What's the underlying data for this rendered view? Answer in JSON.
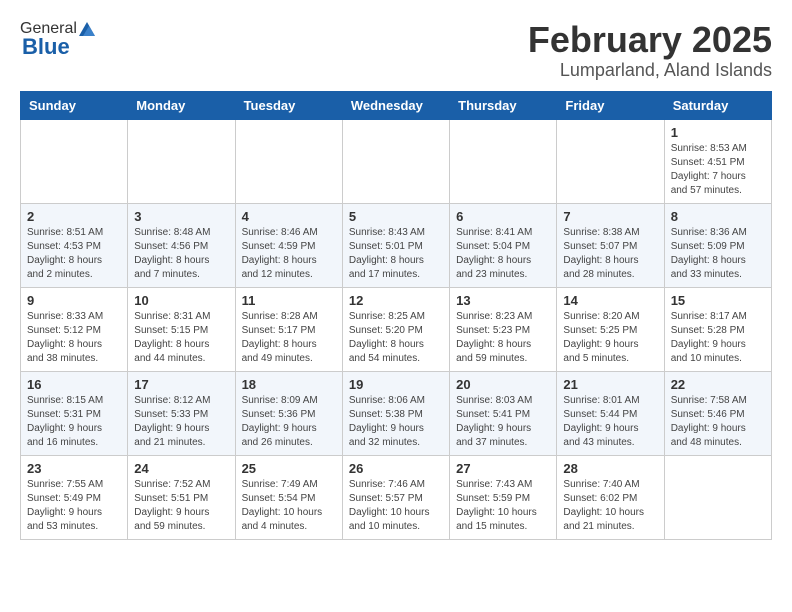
{
  "header": {
    "logo_general": "General",
    "logo_blue": "Blue",
    "month_title": "February 2025",
    "location": "Lumparland, Aland Islands"
  },
  "days_of_week": [
    "Sunday",
    "Monday",
    "Tuesday",
    "Wednesday",
    "Thursday",
    "Friday",
    "Saturday"
  ],
  "weeks": [
    [
      {
        "day": "",
        "info": ""
      },
      {
        "day": "",
        "info": ""
      },
      {
        "day": "",
        "info": ""
      },
      {
        "day": "",
        "info": ""
      },
      {
        "day": "",
        "info": ""
      },
      {
        "day": "",
        "info": ""
      },
      {
        "day": "1",
        "info": "Sunrise: 8:53 AM\nSunset: 4:51 PM\nDaylight: 7 hours\nand 57 minutes."
      }
    ],
    [
      {
        "day": "2",
        "info": "Sunrise: 8:51 AM\nSunset: 4:53 PM\nDaylight: 8 hours\nand 2 minutes."
      },
      {
        "day": "3",
        "info": "Sunrise: 8:48 AM\nSunset: 4:56 PM\nDaylight: 8 hours\nand 7 minutes."
      },
      {
        "day": "4",
        "info": "Sunrise: 8:46 AM\nSunset: 4:59 PM\nDaylight: 8 hours\nand 12 minutes."
      },
      {
        "day": "5",
        "info": "Sunrise: 8:43 AM\nSunset: 5:01 PM\nDaylight: 8 hours\nand 17 minutes."
      },
      {
        "day": "6",
        "info": "Sunrise: 8:41 AM\nSunset: 5:04 PM\nDaylight: 8 hours\nand 23 minutes."
      },
      {
        "day": "7",
        "info": "Sunrise: 8:38 AM\nSunset: 5:07 PM\nDaylight: 8 hours\nand 28 minutes."
      },
      {
        "day": "8",
        "info": "Sunrise: 8:36 AM\nSunset: 5:09 PM\nDaylight: 8 hours\nand 33 minutes."
      }
    ],
    [
      {
        "day": "9",
        "info": "Sunrise: 8:33 AM\nSunset: 5:12 PM\nDaylight: 8 hours\nand 38 minutes."
      },
      {
        "day": "10",
        "info": "Sunrise: 8:31 AM\nSunset: 5:15 PM\nDaylight: 8 hours\nand 44 minutes."
      },
      {
        "day": "11",
        "info": "Sunrise: 8:28 AM\nSunset: 5:17 PM\nDaylight: 8 hours\nand 49 minutes."
      },
      {
        "day": "12",
        "info": "Sunrise: 8:25 AM\nSunset: 5:20 PM\nDaylight: 8 hours\nand 54 minutes."
      },
      {
        "day": "13",
        "info": "Sunrise: 8:23 AM\nSunset: 5:23 PM\nDaylight: 8 hours\nand 59 minutes."
      },
      {
        "day": "14",
        "info": "Sunrise: 8:20 AM\nSunset: 5:25 PM\nDaylight: 9 hours\nand 5 minutes."
      },
      {
        "day": "15",
        "info": "Sunrise: 8:17 AM\nSunset: 5:28 PM\nDaylight: 9 hours\nand 10 minutes."
      }
    ],
    [
      {
        "day": "16",
        "info": "Sunrise: 8:15 AM\nSunset: 5:31 PM\nDaylight: 9 hours\nand 16 minutes."
      },
      {
        "day": "17",
        "info": "Sunrise: 8:12 AM\nSunset: 5:33 PM\nDaylight: 9 hours\nand 21 minutes."
      },
      {
        "day": "18",
        "info": "Sunrise: 8:09 AM\nSunset: 5:36 PM\nDaylight: 9 hours\nand 26 minutes."
      },
      {
        "day": "19",
        "info": "Sunrise: 8:06 AM\nSunset: 5:38 PM\nDaylight: 9 hours\nand 32 minutes."
      },
      {
        "day": "20",
        "info": "Sunrise: 8:03 AM\nSunset: 5:41 PM\nDaylight: 9 hours\nand 37 minutes."
      },
      {
        "day": "21",
        "info": "Sunrise: 8:01 AM\nSunset: 5:44 PM\nDaylight: 9 hours\nand 43 minutes."
      },
      {
        "day": "22",
        "info": "Sunrise: 7:58 AM\nSunset: 5:46 PM\nDaylight: 9 hours\nand 48 minutes."
      }
    ],
    [
      {
        "day": "23",
        "info": "Sunrise: 7:55 AM\nSunset: 5:49 PM\nDaylight: 9 hours\nand 53 minutes."
      },
      {
        "day": "24",
        "info": "Sunrise: 7:52 AM\nSunset: 5:51 PM\nDaylight: 9 hours\nand 59 minutes."
      },
      {
        "day": "25",
        "info": "Sunrise: 7:49 AM\nSunset: 5:54 PM\nDaylight: 10 hours\nand 4 minutes."
      },
      {
        "day": "26",
        "info": "Sunrise: 7:46 AM\nSunset: 5:57 PM\nDaylight: 10 hours\nand 10 minutes."
      },
      {
        "day": "27",
        "info": "Sunrise: 7:43 AM\nSunset: 5:59 PM\nDaylight: 10 hours\nand 15 minutes."
      },
      {
        "day": "28",
        "info": "Sunrise: 7:40 AM\nSunset: 6:02 PM\nDaylight: 10 hours\nand 21 minutes."
      },
      {
        "day": "",
        "info": ""
      }
    ]
  ]
}
